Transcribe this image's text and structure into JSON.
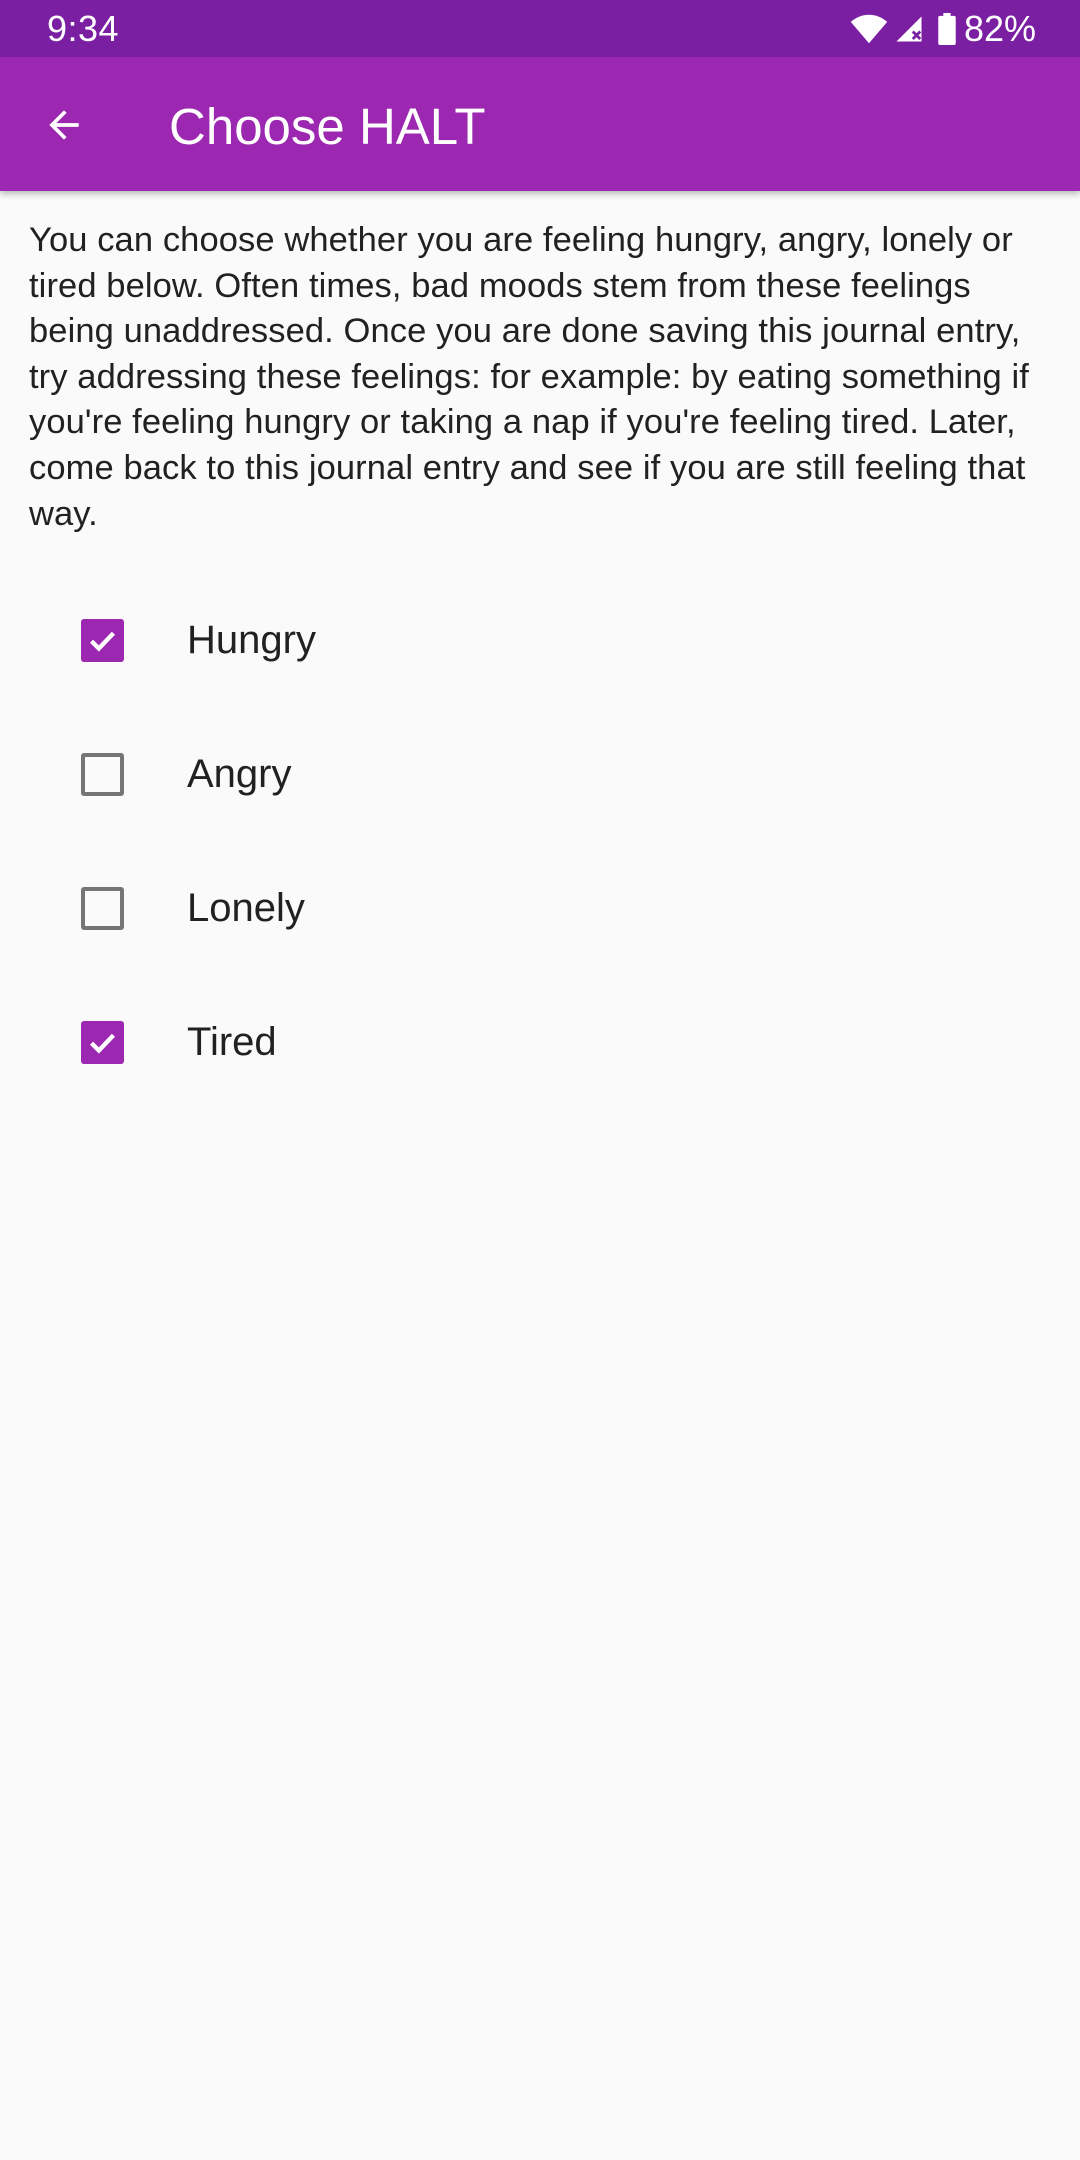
{
  "status_bar": {
    "time": "9:34",
    "battery_percent": "82%",
    "icons": [
      "wifi-icon",
      "cell-signal-icon",
      "battery-icon"
    ]
  },
  "app_bar": {
    "title": "Choose HALT",
    "back_icon": "arrow-back-icon"
  },
  "description": "You can choose whether you are feeling hungry, angry, lonely or tired below. Often times, bad moods stem from these feelings being unaddressed. Once you are done saving this journal entry, try addressing these feelings: for example: by eating something if you're feeling hungry or taking a nap if you're feeling tired. Later, come back to this journal entry and see if you are still feeling that way.",
  "halt_items": [
    {
      "label": "Hungry",
      "checked": true
    },
    {
      "label": "Angry",
      "checked": false
    },
    {
      "label": "Lonely",
      "checked": false
    },
    {
      "label": "Tired",
      "checked": true
    }
  ],
  "colors": {
    "primary": "#9c27b0",
    "primary_dark": "#7b1fa2",
    "background": "#fafafa",
    "text": "#212121",
    "checkbox_unchecked": "#757575"
  }
}
